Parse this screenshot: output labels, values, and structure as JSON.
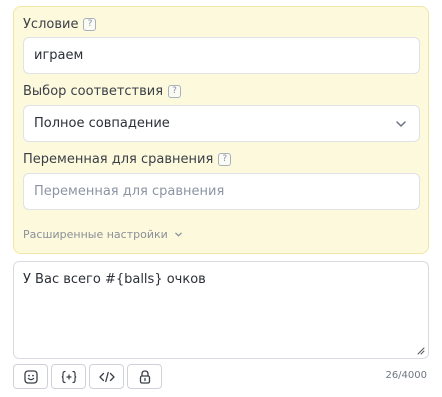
{
  "condition": {
    "label": "Условие",
    "value": "играем"
  },
  "match_type": {
    "label": "Выбор соответствия",
    "selected": "Полное совпадение"
  },
  "compare_variable": {
    "label": "Переменная для сравнения",
    "placeholder": "Переменная для сравнения"
  },
  "advanced_settings": {
    "label": "Расширенные настройки"
  },
  "help_icon": {
    "glyph": "?"
  },
  "message": {
    "text": "У Вас всего #{balls} очков",
    "counter": "26/4000"
  },
  "toolbar": {
    "buttons": [
      {
        "icon": "emoji-icon"
      },
      {
        "icon": "variable-icon"
      },
      {
        "icon": "code-icon"
      },
      {
        "icon": "lock-icon"
      }
    ]
  },
  "colors": {
    "panel_background": "#fdf9dc",
    "panel_border": "#f0e7a6",
    "placeholder_text": "#8c94a3"
  }
}
